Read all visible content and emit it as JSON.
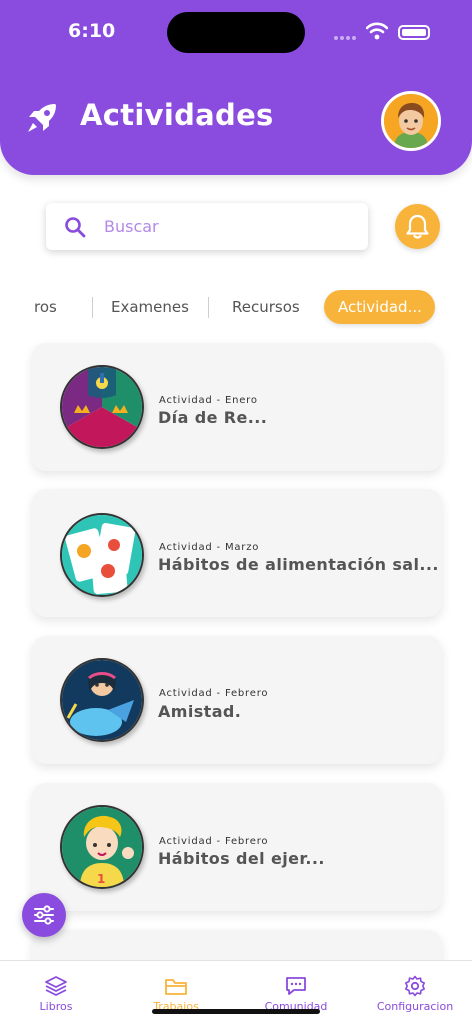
{
  "status_bar": {
    "time": "6:10"
  },
  "header": {
    "title": "Actividades"
  },
  "search": {
    "placeholder": "Buscar",
    "value": ""
  },
  "tabs": [
    {
      "label": "ros"
    },
    {
      "label": "Examenes"
    },
    {
      "label": "Recursos"
    },
    {
      "label": "Actividad...",
      "active": true
    }
  ],
  "cards": [
    {
      "meta": "Actividad - Enero",
      "title": "Día de Re..."
    },
    {
      "meta": "Actividad - Marzo",
      "title": "Hábitos de alimentación sal..."
    },
    {
      "meta": "Actividad - Febrero",
      "title": "Amistad."
    },
    {
      "meta": "Actividad - Febrero",
      "title": "Hábitos del ejer..."
    }
  ],
  "bottom_nav": [
    {
      "label": "Libros",
      "icon": "layers-icon"
    },
    {
      "label": "Trabajos",
      "icon": "folder-icon",
      "active": true
    },
    {
      "label": "Comunidad",
      "icon": "chat-icon"
    },
    {
      "label": "Configuracion",
      "icon": "gear-icon"
    }
  ],
  "colors": {
    "primary": "#8a4bdf",
    "accent": "#f8b33a",
    "card_bg": "#f5f5f5"
  }
}
